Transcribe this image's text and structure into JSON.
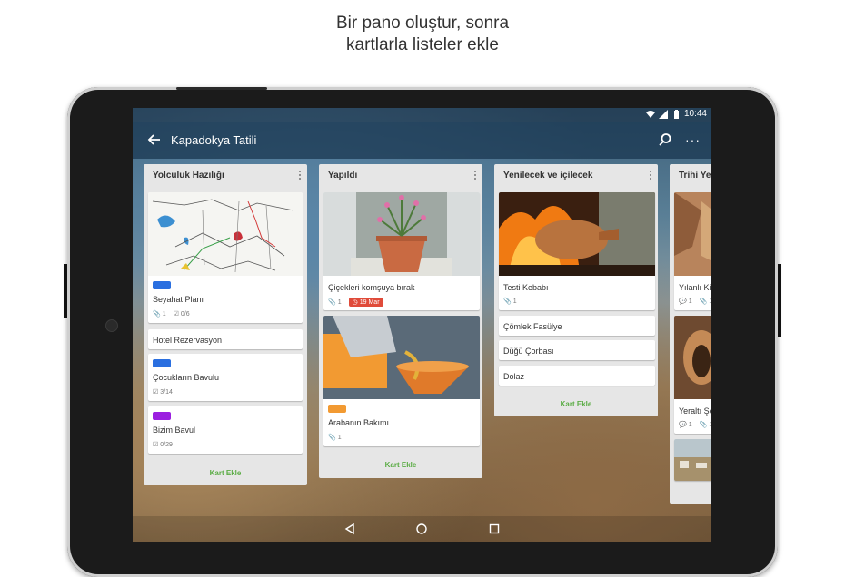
{
  "headline": {
    "line1": "Bir pano oluştur, sonra",
    "line2": "kartlarla listeler ekle"
  },
  "statusbar": {
    "time": "10:44",
    "icons": [
      "wifi-icon",
      "signal-icon",
      "battery-icon"
    ]
  },
  "appbar": {
    "title": "Kapadokya Tatili",
    "back_icon": "arrow-left-icon",
    "search_icon": "search-icon",
    "menu_glyph": "···"
  },
  "lists": [
    {
      "title": "Yolculuk Hazılığı",
      "cards": [
        {
          "title": "Seyahat Planı",
          "label_color": "#2a6fe0",
          "attachments": "1",
          "checklist": "0/6",
          "image": "map"
        },
        {
          "title": "Hotel Rezervasyon"
        },
        {
          "title": "Çocukların Bavulu",
          "label_color": "#2a6fe0",
          "checklist": "3/14"
        },
        {
          "title": "Bizim Bavul",
          "label_color": "#9b1fe0",
          "checklist": "0/29"
        }
      ],
      "add_card": "Kart Ekle"
    },
    {
      "title": "Yapıldı",
      "cards": [
        {
          "title": "Çiçekleri komşuya bırak",
          "attachments": "1",
          "due": "19 Mar",
          "image": "flowerpot"
        },
        {
          "title": "Arabanın Bakımı",
          "label_color": "#f29a32",
          "attachments": "1",
          "image": "oil"
        }
      ],
      "add_card": "Kart Ekle"
    },
    {
      "title": "Yenilecek ve içilecek",
      "cards": [
        {
          "title": "Testi Kebabı",
          "attachments": "1",
          "image": "clay-pot"
        },
        {
          "title": "Çömlek Fasülye"
        },
        {
          "title": "Düğü Çorbası"
        },
        {
          "title": "Dolaz"
        }
      ],
      "add_card": "Kart Ekle"
    },
    {
      "title": "Trihi Yer",
      "cards": [
        {
          "title": "Yılanlı Kil",
          "comments": "1",
          "attachments": "1",
          "image": "fresco"
        },
        {
          "title": "Yeraltı Şe",
          "comments": "1",
          "attachments": "1",
          "image": "cave"
        },
        {
          "title": "",
          "image": "landscape"
        }
      ]
    }
  ],
  "colors": {
    "accent_green": "#5aac44",
    "due_red": "#e04b3a",
    "appbar": "#19374f"
  },
  "navbar": {
    "icons": [
      "back-triangle-icon",
      "home-circle-icon",
      "recents-square-icon"
    ]
  }
}
